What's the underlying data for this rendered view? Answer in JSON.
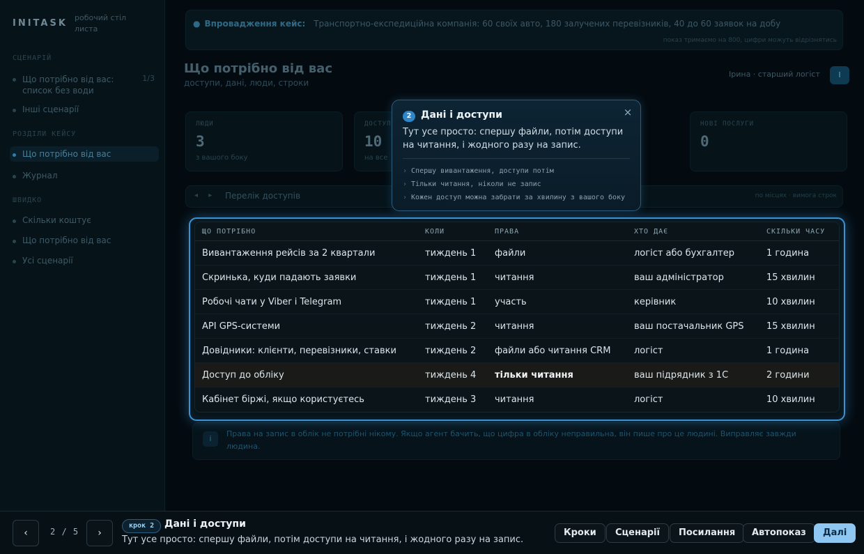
{
  "app": {
    "brand": "INITASK",
    "brand_sub": "робочий стіл листа",
    "sidebar": {
      "section1": "СЦЕНАРІЙ",
      "item1_label": "Що потрібно від вас: список без води",
      "item1_count": "1/3",
      "item2_label": "Інші сценарії",
      "section2": "РОЗДІЛИ КЕЙСУ",
      "item3_label": "Що потрібно від вас",
      "item4_label": "Журнал",
      "section3": "ШВИДКО",
      "item5_label": "Скільки коштує",
      "item6_label": "Що потрібно від вас",
      "item7_label": "Усі сценарії"
    },
    "banner": {
      "label": "Впровадження кейс:",
      "text": "Транспортно-експедиційна компанія: 60 своїх авто, 180 залучених перевізників, 40 до 60 заявок на добу",
      "meta": "показ тримаємо на 800, цифри можуть відрізнятись"
    },
    "page_title": "Що потрібно від вас",
    "page_subtitle": "доступи, дані, люди, строки",
    "role_label": "Ірина · старший логіст",
    "avatar": "І",
    "stats": [
      {
        "label": "ЛЮДИ",
        "value": "3",
        "sub": "з вашого боку"
      },
      {
        "label": "ДОСТУПИ",
        "value": "10",
        "sub": "на все"
      },
      {
        "label": "НОВІ ПОСЛУГИ",
        "value": "0",
        "sub": ""
      }
    ],
    "section_title": "Перелік доступів",
    "section_meta": "по місцях · вимога строк",
    "note": "Права на запис в облік не потрібні нікому. Якщо агент бачить, що цифра в обліку неправильна, він пише про це людині. Виправляє завжди людина."
  },
  "table": {
    "headers": [
      "ЩО ПОТРІБНО",
      "КОЛИ",
      "ПРАВА",
      "ХТО ДАЄ",
      "СКІЛЬКИ ЧАСУ"
    ],
    "rows": [
      [
        "Вивантаження рейсів за 2 квартали",
        "тиждень 1",
        "файли",
        "логіст або бухгалтер",
        "1 година"
      ],
      [
        "Скринька, куди падають заявки",
        "тиждень 1",
        "читання",
        "ваш адміністратор",
        "15 хвилин"
      ],
      [
        "Робочі чати у Viber і Telegram",
        "тиждень 1",
        "участь",
        "керівник",
        "10 хвилин"
      ],
      [
        "API GPS-системи",
        "тиждень 2",
        "читання",
        "ваш постачальник GPS",
        "15 хвилин"
      ],
      [
        "Довідники: клієнти, перевізники, ставки",
        "тиждень 2",
        "файли або читання CRM",
        "логіст",
        "1 година"
      ],
      [
        "Доступ до обліку",
        "тиждень 4",
        "тільки читання",
        "ваш підрядник з 1С",
        "2 години"
      ],
      [
        "Кабінет біржі, якщо користуєтесь",
        "тиждень 3",
        "читання",
        "логіст",
        "10 хвилин"
      ]
    ]
  },
  "tooltip": {
    "step_num": "2",
    "title": "Дані і доступи",
    "desc": "Тут усе просто: спершу файли, потім доступи на читання, і жодного разу на запис.",
    "close": "×",
    "bullets": [
      "Спершу вивантаження, доступи потім",
      "Тільки читання, ніколи не запис",
      "Кожен доступ можна забрати за хвилину з вашого боку"
    ],
    "bullet_arrow": "›"
  },
  "bottom": {
    "prev": "‹",
    "next": "›",
    "counter": "2 / 5",
    "step_pill": "крок 2",
    "title": "Дані і доступи",
    "desc": "Тут усе просто: спершу файли, потім доступи на читання, і жодного разу на запис.",
    "buttons": {
      "steps": "Кроки",
      "scenarios": "Сценарії",
      "links": "Посилання",
      "autoplay": "Автопоказ",
      "next": "Далі"
    }
  }
}
